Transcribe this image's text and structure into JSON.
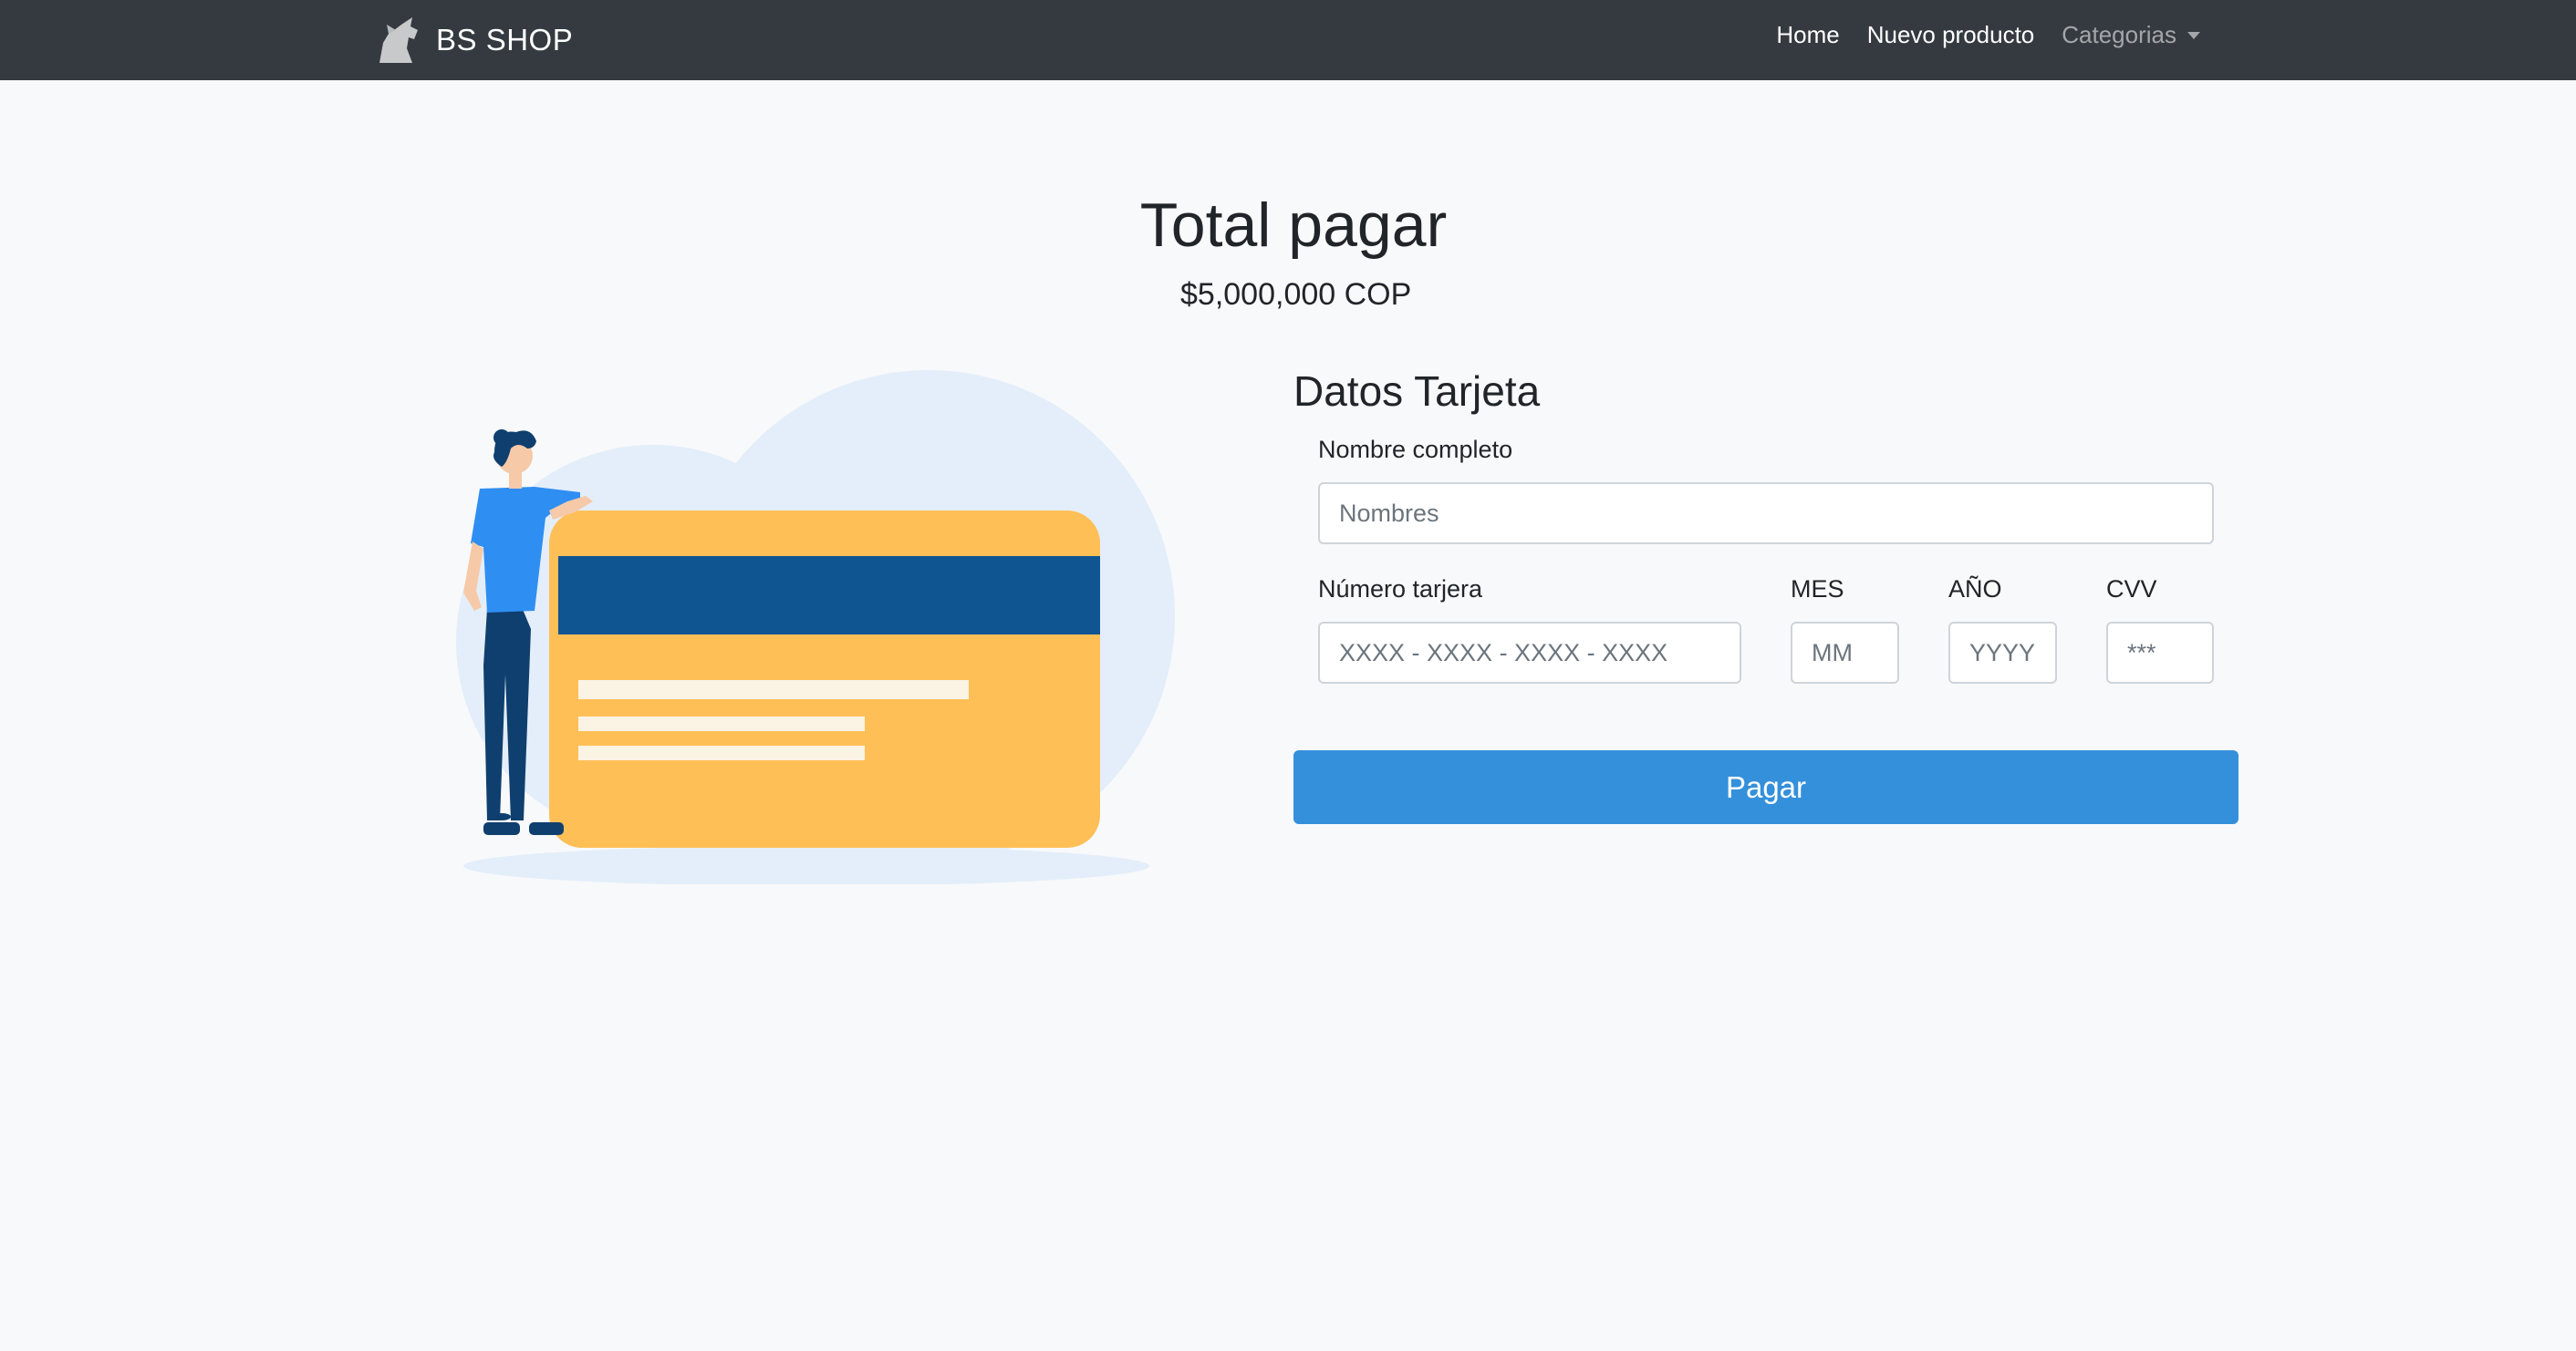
{
  "navbar": {
    "brand": "BS SHOP",
    "links": [
      "Home",
      "Nuevo producto",
      "Categorias"
    ]
  },
  "summary": {
    "title": "Total pagar",
    "amount": "$5,000,000 COP"
  },
  "form": {
    "title": "Datos Tarjeta",
    "name_label": "Nombre completo",
    "name_placeholder": "Nombres",
    "card_label": "Número tarjera",
    "card_placeholder": "XXXX - XXXX - XXXX - XXXX",
    "month_label": "MES",
    "month_placeholder": "MM",
    "year_label": "AÑO",
    "year_placeholder": "YYYY",
    "cvv_label": "CVV",
    "cvv_placeholder": "***",
    "submit_label": "Pagar"
  },
  "colors": {
    "navbar_bg": "#343a40",
    "page_bg": "#f8f9fa",
    "primary": "#3590dc",
    "card_yellow": "#ffbf57",
    "card_stripe": "#0f5591",
    "illustration_bg": "#e3eefa"
  },
  "icons": {
    "brand_logo": "wolf-icon",
    "dropdown": "caret-down-icon"
  }
}
